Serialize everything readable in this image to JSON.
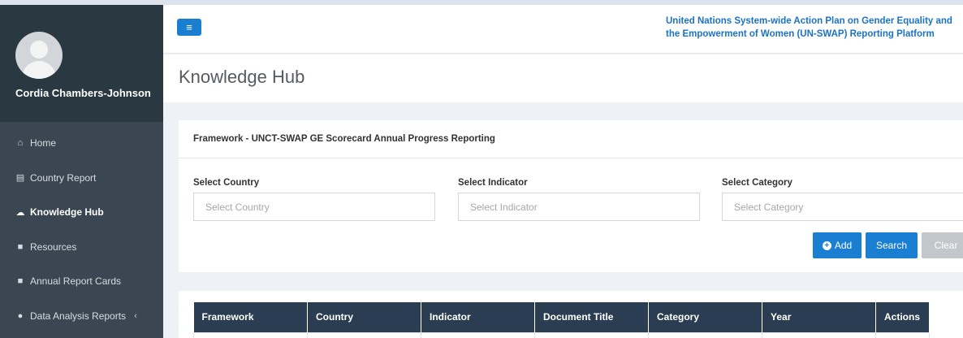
{
  "sidebar": {
    "user_name": "Cordia Chambers-Johnson",
    "items": [
      {
        "label": "Home",
        "icon": "home-icon",
        "glyph": "⌂"
      },
      {
        "label": "Country Report",
        "icon": "file-icon",
        "glyph": "▤"
      },
      {
        "label": "Knowledge Hub",
        "icon": "cloud-icon",
        "glyph": "☁"
      },
      {
        "label": "Resources",
        "icon": "briefcase-icon",
        "glyph": "■"
      },
      {
        "label": "Annual Report Cards",
        "icon": "briefcase-icon",
        "glyph": "■"
      },
      {
        "label": "Data Analysis Reports",
        "icon": "globe-icon",
        "glyph": "●",
        "chevron": "‹"
      }
    ]
  },
  "topbar": {
    "menu_glyph": "≡",
    "platform_title_line1": "United Nations System-wide Action Plan on Gender Equality and",
    "platform_title_line2": "the Empowerment of Women (UN-SWAP) Reporting Platform"
  },
  "page": {
    "title": "Knowledge Hub"
  },
  "filter_panel": {
    "framework": "Framework - UNCT-SWAP GE Scorecard Annual Progress Reporting",
    "country_label": "Select Country",
    "country_placeholder": "Select Country",
    "indicator_label": "Select Indicator",
    "indicator_placeholder": "Select Indicator",
    "category_label": "Select Category",
    "category_placeholder": "Select Category",
    "add_label": "Add",
    "search_label": "Search",
    "clear_label": "Clear"
  },
  "table": {
    "columns": [
      "Framework",
      "Country",
      "Indicator",
      "Document Title",
      "Category",
      "Year",
      "Actions"
    ]
  },
  "colors": {
    "sidebar": "#3a4651",
    "accent": "#1a7fd0",
    "table_header": "#2a3d52"
  }
}
